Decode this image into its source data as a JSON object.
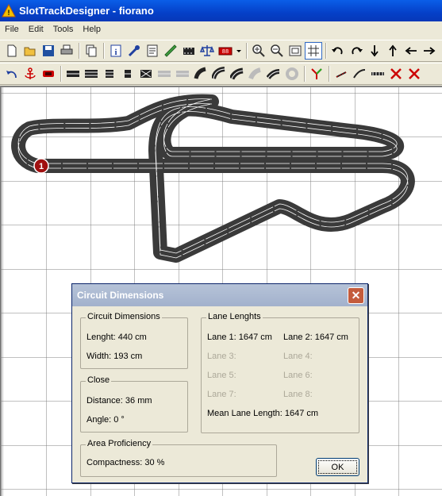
{
  "window": {
    "title": "SlotTrackDesigner - fiorano"
  },
  "menu": {
    "items": [
      "File",
      "Edit",
      "Tools",
      "Help"
    ]
  },
  "toolbar": {
    "row1": [
      "new-icon",
      "open-icon",
      "save-icon",
      "print-icon",
      "copy-icon",
      "info-icon",
      "tools-icon",
      "document-icon",
      "ruler-icon",
      "film-icon",
      "scale-icon",
      "lap-counter-icon",
      "dropdown-icon",
      "zoom-in-icon",
      "zoom-out-icon",
      "fit-icon",
      "grid-icon",
      "rotate-left-icon",
      "rotate-right-icon",
      "arrow-down-icon",
      "arrow-up-icon",
      "arrow-left-icon",
      "arrow-right-icon"
    ],
    "row2": [
      "undo-icon",
      "anchor-icon",
      "car-icon",
      "straight-track-icon",
      "double-straight-icon",
      "half-straight-icon",
      "quarter-straight-icon",
      "crossover-icon",
      "straight-disabled-icon",
      "straight-disabled-2-icon",
      "curve-icon",
      "curve-2-icon",
      "curve-3-icon",
      "curve-disabled-icon",
      "curve-4-icon",
      "curve-disabled-2-icon",
      "junction-icon",
      "border-icon",
      "border-2-icon",
      "fence-icon",
      "delete-icon",
      "delete-2-icon"
    ]
  },
  "track": {
    "start_marker": "1"
  },
  "dialog": {
    "title": "Circuit Dimensions",
    "ok_label": "OK",
    "circuit": {
      "title": "Circuit Dimensions",
      "length": "Lenght: 440 cm",
      "width": "Width: 193 cm"
    },
    "close": {
      "title": "Close",
      "distance": "Distance: 36 mm",
      "angle": "Angle: 0 °"
    },
    "area": {
      "title": "Area Proficiency",
      "compactness": "Compactness: 30 %"
    },
    "lanes": {
      "title": "Lane Lenghts",
      "lane1": "Lane 1: 1647 cm",
      "lane2": "Lane 2: 1647 cm",
      "lane3": "Lane 3:",
      "lane4": "Lane 4:",
      "lane5": "Lane 5:",
      "lane6": "Lane 6:",
      "lane7": "Lane 7:",
      "lane8": "Lane 8:",
      "mean": "Mean Lane Length: 1647 cm"
    }
  },
  "colors": {
    "track": "#3a3a3a",
    "lane_line": "#ffffff",
    "grid": "#808080",
    "start_marker": "#a01010"
  }
}
